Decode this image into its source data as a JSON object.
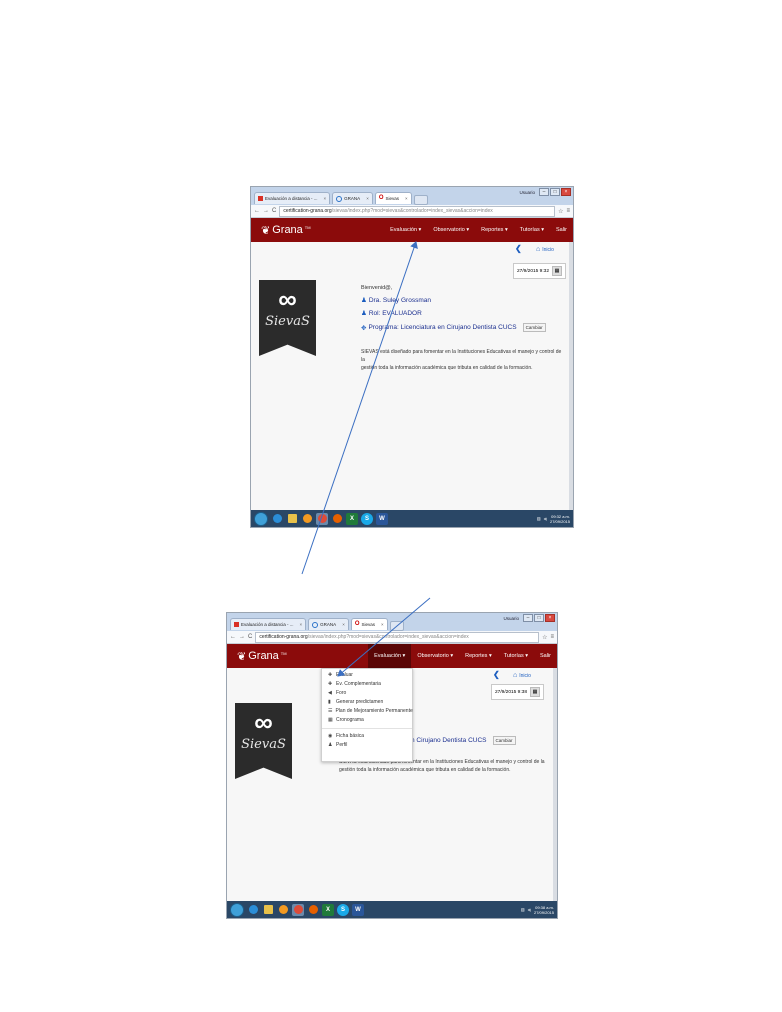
{
  "shots": [
    {
      "tabs": [
        {
          "label": "Evaluación a distancia - ...",
          "icon": "gmail-icon"
        },
        {
          "label": "GRANA",
          "icon": "chrome-icon"
        },
        {
          "label": "Sievas",
          "icon": "opera-icon"
        }
      ],
      "window_user": "Usuario",
      "address": {
        "host": "certification-grana.org",
        "path": "/sievas/index.php?mod=sievas&controlador=index_sievas&accion=index"
      },
      "brand": "Grana",
      "brand_tm": "TM",
      "menu": [
        "Evaluación ▾",
        "Observatorio ▾",
        "Reportes ▾",
        "Tutorías ▾",
        "Salir"
      ],
      "home_label": "Inicio",
      "date": "27/9/2015 9:32",
      "logo_text": "SievaS",
      "greeting": "Bienvenid@,",
      "user_line": "Dra. Suley Grossman",
      "role_line": "Rol: EVALUADOR",
      "program_line": "Programa: Licenciatura en Cirujano Dentista CUCS",
      "cambiar": "Cambiar",
      "desc_line1": "SIEVAS está diseñado para fomentar en la Instituciones Educativas el manejo y control de la",
      "desc_line2": "gestión toda la información académica que tributa en calidad de la formación.",
      "clock_time": "09:32 a.m.",
      "clock_date": "27/09/2015"
    },
    {
      "tabs": [
        {
          "label": "Evaluación a distancia - ...",
          "icon": "gmail-icon"
        },
        {
          "label": "GRANA",
          "icon": "chrome-icon"
        },
        {
          "label": "Sievas",
          "icon": "opera-icon"
        }
      ],
      "window_user": "Usuario",
      "address": {
        "host": "certification-grana.org",
        "path": "/sievas/index.php?mod=sievas&controlador=index_sievas&accion=index"
      },
      "brand": "Grana",
      "brand_tm": "TM",
      "menu": [
        "Evaluación ▾",
        "Observatorio ▾",
        "Reportes ▾",
        "Tutorías ▾",
        "Salir"
      ],
      "home_label": "Inicio",
      "date": "27/9/2015 9:38",
      "logo_text": "SievaS",
      "program_partial": "n Cirujano Dentista CUCS",
      "cambiar": "Cambiar",
      "desc_line1": "SIEVAS está diseñado para fomentar en la Instituciones Educativas el manejo y control de la",
      "desc_line2": "gestión toda la información académica que tributa en calidad de la formación.",
      "dropdown": [
        "Evaluar",
        "Ev. Complementaria",
        "Foro",
        "Generar predictamen",
        "Plan de Mejoramiento Permanente",
        "Cronograma",
        "Ficha básica",
        "Perfil"
      ],
      "clock_time": "09:38 a.m.",
      "clock_date": "27/09/2015"
    }
  ],
  "colors": {
    "navbar": "#8b0b0b",
    "link": "#1c5dbf",
    "taskbar": "#2a4766",
    "arrow": "#3b6fc2"
  }
}
